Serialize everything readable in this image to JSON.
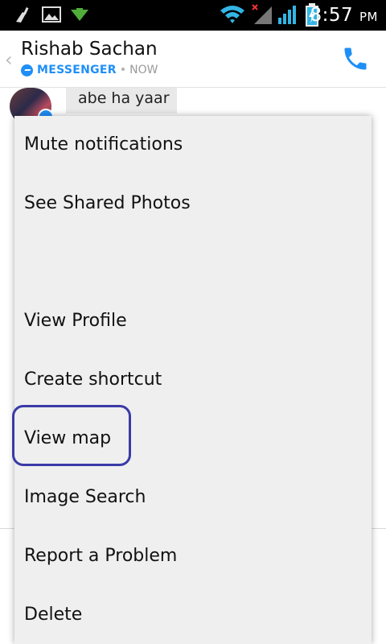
{
  "status_bar": {
    "time": "8:57",
    "ampm": "PM",
    "icons": [
      "broom-icon",
      "image-icon",
      "download-icon",
      "wifi-icon",
      "no-signal-icon",
      "signal-icon",
      "battery-charging-icon"
    ]
  },
  "header": {
    "contact_name": "Rishab Sachan",
    "app_label": "MESSENGER",
    "separator": "•",
    "status": "NOW"
  },
  "chat": {
    "message": "abe ha yaar"
  },
  "menu": {
    "items": [
      "Mute notifications",
      "See Shared Photos",
      "",
      "View Profile",
      "Create shortcut",
      "View map",
      "Image Search",
      "Report a Problem",
      "Delete"
    ]
  },
  "colors": {
    "accent": "#1f8ff7",
    "highlight": "#3a3aa8",
    "menu_bg": "#efefef"
  }
}
